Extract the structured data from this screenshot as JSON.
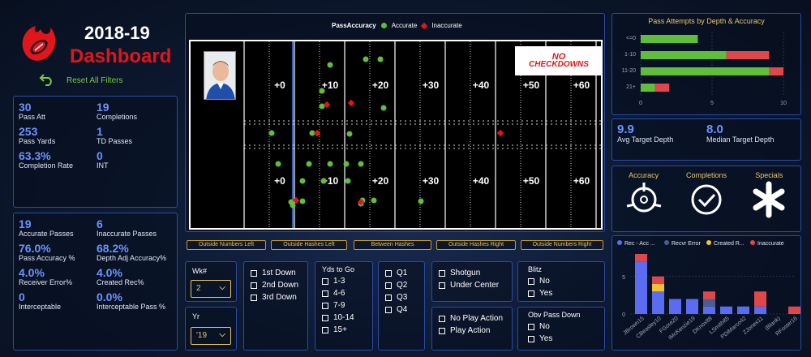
{
  "header": {
    "season": "2018-19",
    "title": "Dashboard",
    "reset": "Reset All Filters"
  },
  "stats1": [
    {
      "v": "30",
      "l": "Pass Att"
    },
    {
      "v": "19",
      "l": "Completions"
    },
    {
      "v": "253",
      "l": "Pass Yards"
    },
    {
      "v": "1",
      "l": "TD Passes"
    },
    {
      "v": "63.3%",
      "l": "Completion Rate"
    },
    {
      "v": "0",
      "l": "INT"
    }
  ],
  "stats2": [
    {
      "v": "19",
      "l": "Accurate Passes"
    },
    {
      "v": "6",
      "l": "Inaccurate Passes"
    },
    {
      "v": "76.0%",
      "l": "Pass Accuracy %"
    },
    {
      "v": "68.2%",
      "l": "Depth Adj Accuracy%"
    },
    {
      "v": "4.0%",
      "l": "Receiver Error%"
    },
    {
      "v": "4.0%",
      "l": "Created Rec%"
    },
    {
      "v": "0",
      "l": "Interceptable"
    },
    {
      "v": "0.0%",
      "l": "Interceptable Pass %"
    }
  ],
  "field": {
    "legend_title": "PassAccuracy",
    "legend_accurate": "Accurate",
    "legend_inaccurate": "Inaccurate",
    "yard_labels": [
      "+0",
      "+10",
      "+20",
      "+30",
      "+40",
      "+50",
      "+60"
    ],
    "logo_line1": "NO",
    "logo_line2": "CHECKDOWNS",
    "accurate_color": "#5fbf3a",
    "inaccurate_color": "#e0161b"
  },
  "zones": [
    "Outside Numbers Left",
    "Outside Hashes Left",
    "Between Hashes",
    "Outside Hashes Right",
    "Outside Numbers Right"
  ],
  "filters": {
    "wk_label": "Wk#",
    "wk_value": "2",
    "yr_label": "Yr",
    "yr_value": "'19",
    "downs": [
      "1st Down",
      "2nd Down",
      "3rd Down"
    ],
    "ydstogo_label": "Yds to Go",
    "ydstogo": [
      "1-3",
      "4-6",
      "7-9",
      "10-14",
      "15+"
    ],
    "quarters": [
      "Q1",
      "Q2",
      "Q3",
      "Q4"
    ],
    "formation": [
      "Shotgun",
      "Under Center"
    ],
    "playaction": [
      "No Play Action",
      "Play Action"
    ],
    "blitz_label": "Blitz",
    "blitz": [
      "No",
      "Yes"
    ],
    "obv_label": "Obv Pass Down",
    "obv": [
      "No",
      "Yes"
    ]
  },
  "depth_chart": {
    "title": "Pass Attempts by Depth & Accuracy",
    "colors": {
      "accurate": "#5fbf3a",
      "inaccurate": "#e0474a"
    },
    "chart_data": {
      "type": "bar",
      "categories": [
        "<=0",
        "1-10",
        "11-20",
        "21+"
      ],
      "series": [
        {
          "name": "Accurate",
          "values": [
            4,
            6,
            9,
            1
          ]
        },
        {
          "name": "Inaccurate",
          "values": [
            0,
            3,
            1,
            1
          ]
        }
      ],
      "xlim": [
        0,
        10
      ],
      "xticks": [
        "0",
        "5",
        "10"
      ]
    }
  },
  "depth_stats": [
    {
      "v": "9.9",
      "l": "Avg Target Depth"
    },
    {
      "v": "8.0",
      "l": "Median Target Depth"
    }
  ],
  "icons": [
    {
      "l": "Accuracy",
      "n": "crosshair-icon"
    },
    {
      "l": "Completions",
      "n": "check-circle-icon"
    },
    {
      "l": "Specials",
      "n": "asterisk-icon"
    }
  ],
  "receiver_chart": {
    "legend": [
      "Rec - Acc ...",
      "Recvr Error",
      "Created R...",
      "Inaccurate"
    ],
    "colors": [
      "#5b6cf0",
      "#4a5f8f",
      "#f2c12e",
      "#e0474a"
    ],
    "chart_data": {
      "type": "bar",
      "categories": [
        "JBrown15",
        "CBeasley10",
        "FGore20",
        "IMcKenzie19",
        "DKnox88",
        "LSmith85",
        "PDiMarco42",
        "ZJones11",
        "(Blank)",
        "RFoster16"
      ],
      "series": [
        {
          "name": "Rec - Acc ...",
          "values": [
            7,
            3,
            2,
            2,
            1,
            1,
            1,
            1,
            0,
            0
          ]
        },
        {
          "name": "Recvr Error",
          "values": [
            0,
            0,
            0,
            0,
            1,
            0,
            0,
            0,
            0,
            0
          ]
        },
        {
          "name": "Created R...",
          "values": [
            0,
            1,
            0,
            0,
            0,
            0,
            0,
            0,
            0,
            0
          ]
        },
        {
          "name": "Inaccurate",
          "values": [
            1,
            1,
            0,
            0,
            1,
            0,
            0,
            2,
            0,
            1
          ]
        }
      ],
      "yticks": [
        "0",
        "5"
      ],
      "ylim": [
        0,
        8
      ]
    }
  }
}
